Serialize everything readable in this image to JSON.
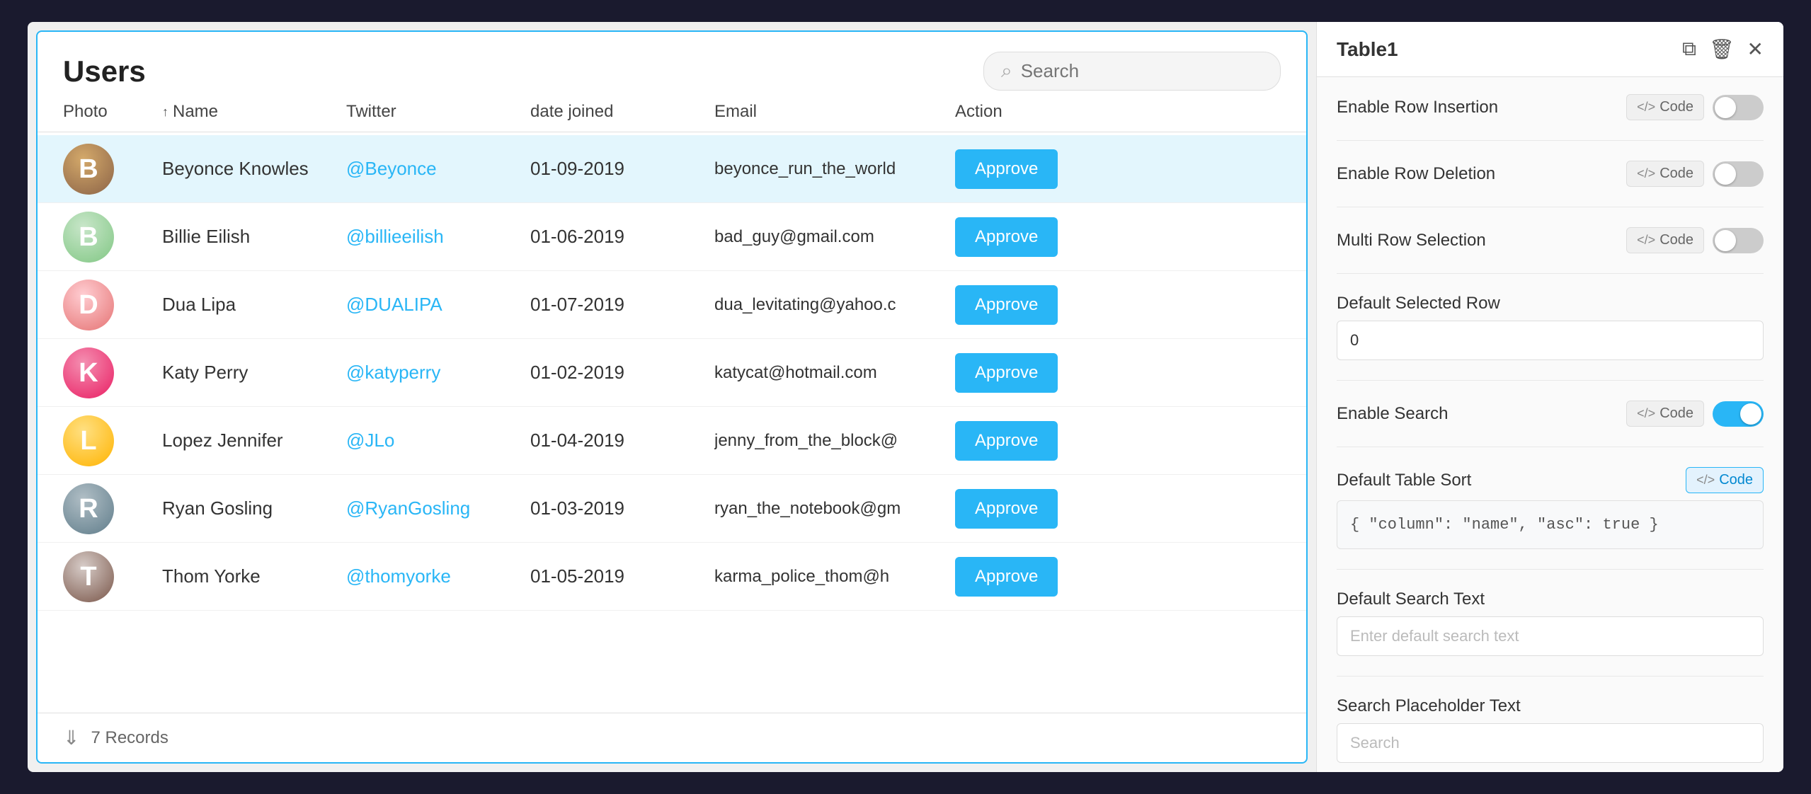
{
  "table": {
    "title": "Users",
    "search_placeholder": "Search",
    "columns": [
      {
        "label": "Photo",
        "sortable": false
      },
      {
        "label": "Name",
        "sortable": true
      },
      {
        "label": "Twitter",
        "sortable": false
      },
      {
        "label": "date joined",
        "sortable": false
      },
      {
        "label": "Email",
        "sortable": false
      },
      {
        "label": "Action",
        "sortable": false
      }
    ],
    "rows": [
      {
        "name": "Beyonce Knowles",
        "twitter": "@Beyonce",
        "date_joined": "01-09-2019",
        "email": "beyonce_run_the_world",
        "action": "Approve",
        "avatar_class": "avatar-beyonce",
        "avatar_letter": "B",
        "selected": true
      },
      {
        "name": "Billie Eilish",
        "twitter": "@billieeilish",
        "date_joined": "01-06-2019",
        "email": "bad_guy@gmail.com",
        "action": "Approve",
        "avatar_class": "avatar-billie",
        "avatar_letter": "B",
        "selected": false
      },
      {
        "name": "Dua Lipa",
        "twitter": "@DUALIPA",
        "date_joined": "01-07-2019",
        "email": "dua_levitating@yahoo.c",
        "action": "Approve",
        "avatar_class": "avatar-dua",
        "avatar_letter": "D",
        "selected": false
      },
      {
        "name": "Katy Perry",
        "twitter": "@katyperry",
        "date_joined": "01-02-2019",
        "email": "katycat@hotmail.com",
        "action": "Approve",
        "avatar_class": "avatar-katy",
        "avatar_letter": "K",
        "selected": false
      },
      {
        "name": "Lopez Jennifer",
        "twitter": "@JLo",
        "date_joined": "01-04-2019",
        "email": "jenny_from_the_block@",
        "action": "Approve",
        "avatar_class": "avatar-lopez",
        "avatar_letter": "L",
        "selected": false
      },
      {
        "name": "Ryan Gosling",
        "twitter": "@RyanGosling",
        "date_joined": "01-03-2019",
        "email": "ryan_the_notebook@gm",
        "action": "Approve",
        "avatar_class": "avatar-ryan",
        "avatar_letter": "R",
        "selected": false
      },
      {
        "name": "Thom Yorke",
        "twitter": "@thomyorke",
        "date_joined": "01-05-2019",
        "email": "karma_police_thom@h",
        "action": "Approve",
        "avatar_class": "avatar-thom",
        "avatar_letter": "T",
        "selected": false
      }
    ],
    "footer_records": "7 Records"
  },
  "settings": {
    "title": "Table1",
    "enable_row_insertion_label": "Enable Row Insertion",
    "enable_row_insertion_on": false,
    "enable_row_deletion_label": "Enable Row Deletion",
    "enable_row_deletion_on": false,
    "multi_row_selection_label": "Multi Row Selection",
    "multi_row_selection_on": false,
    "default_selected_row_label": "Default Selected Row",
    "default_selected_row_value": "0",
    "enable_search_label": "Enable Search",
    "enable_search_on": true,
    "default_table_sort_label": "Default Table Sort",
    "default_table_sort_code": "{\n  \"column\": \"name\",\n  \"asc\": true\n}",
    "default_search_text_label": "Default Search Text",
    "default_search_text_placeholder": "Enter default search text",
    "search_placeholder_text_label": "Search Placeholder Text",
    "search_placeholder_value": "Search",
    "code_label": "Code",
    "icons": {
      "copy": "⧉",
      "trash": "🗑",
      "close": "✕",
      "code": "</>",
      "search": "🔍",
      "download": "⬇"
    }
  }
}
